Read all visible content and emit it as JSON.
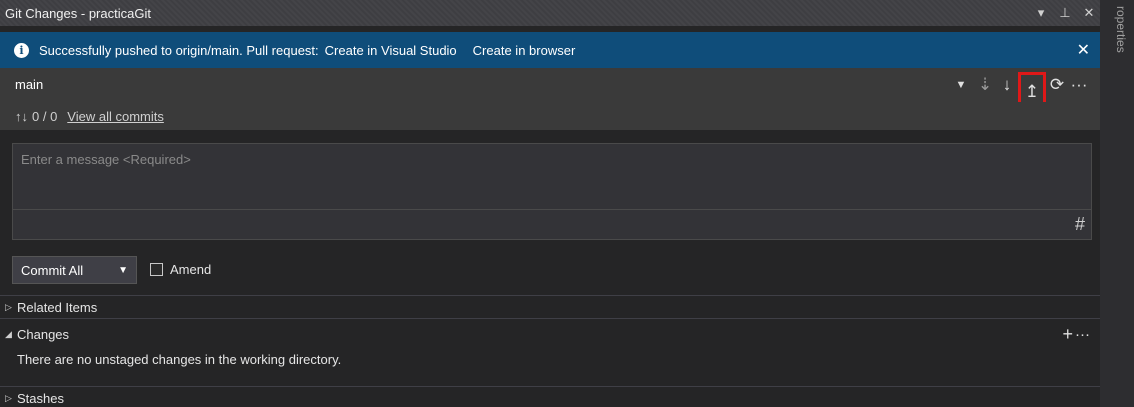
{
  "window": {
    "title": "Git Changes - practicaGit",
    "icons": [
      "chevron-down-icon",
      "pin-icon",
      "close-icon"
    ]
  },
  "infobar": {
    "message": "Successfully pushed to origin/main. Pull request:",
    "link1": "Create in Visual Studio",
    "link2": "Create in browser"
  },
  "branch": {
    "name": "main"
  },
  "toolbar": {
    "icons": [
      "branch-dropdown-icon",
      "fetch-icon",
      "pull-icon",
      "push-icon",
      "sync-icon",
      "more-icon"
    ],
    "highlighted": "push-icon",
    "highlight_color": "#e01818"
  },
  "commits": {
    "counts": "0 / 0",
    "view_all": "View all commits"
  },
  "message_box": {
    "placeholder": "Enter a message <Required>"
  },
  "commit": {
    "button_label": "Commit All",
    "amend_label": "Amend"
  },
  "sections": {
    "related_items": "Related Items",
    "changes": "Changes",
    "changes_empty": "There are no unstaged changes in the working directory.",
    "stashes": "Stashes"
  },
  "rail": {
    "tab_label": "roperties"
  },
  "colors": {
    "accent": "#0f4d7a",
    "panel_bg": "#252526",
    "titlebar_bg": "#3e3e42"
  }
}
